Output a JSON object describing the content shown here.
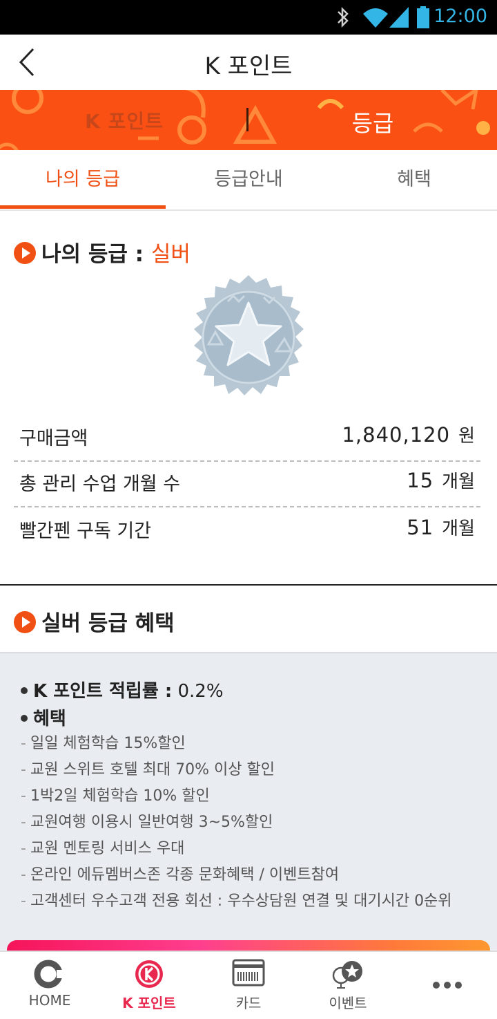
{
  "status_bar": {
    "time": "12:00"
  },
  "header": {
    "title": "K 포인트"
  },
  "banner": {
    "left_label": "K 포인트",
    "right_label": "등급"
  },
  "tabs": [
    {
      "label": "나의 등급",
      "active": true
    },
    {
      "label": "등급안내",
      "active": false
    },
    {
      "label": "혜택",
      "active": false
    }
  ],
  "my_grade": {
    "title_prefix": "나의 등급 :",
    "grade": "실버",
    "rows": [
      {
        "label": "구매금액",
        "value": "1,840,120",
        "unit": "원"
      },
      {
        "label": "총 관리 수업 개월 수",
        "value": "15",
        "unit": "개월"
      },
      {
        "label": "빨간펜 구독 기간",
        "value": "51",
        "unit": "개월"
      }
    ]
  },
  "benefits": {
    "title": "실버 등급 혜택",
    "rate_label": "K 포인트 적립률 :",
    "rate_value": "0.2%",
    "benefit_heading": "혜택",
    "items": [
      "일일 체험학습 15%할인",
      "교원 스위트 호텔 최대 70% 이상 할인",
      "1박2일 체험학습 10% 할인",
      "교원여행 이용시 일반여행 3~5%할인",
      "교원 멘토링 서비스 우대",
      "온라인 에듀멤버스존 각종 문화혜택 / 이벤트참여",
      "고객센터 우수고객 전용 회선 : 우수상담원 연결 및 대기시간 0순위"
    ]
  },
  "bottom_nav": [
    {
      "label": "HOME",
      "icon": "home-icon",
      "active": false
    },
    {
      "label": "K 포인트",
      "icon": "k-point-icon",
      "active": true
    },
    {
      "label": "카드",
      "icon": "card-icon",
      "active": false
    },
    {
      "label": "이벤트",
      "icon": "event-icon",
      "active": false
    },
    {
      "label": "",
      "icon": "more-icon",
      "active": false
    }
  ],
  "colors": {
    "accent": "#f05014",
    "banner": "#fa5014",
    "badge_silver": "#b7c8d4",
    "nav_active": "#e8284e"
  }
}
